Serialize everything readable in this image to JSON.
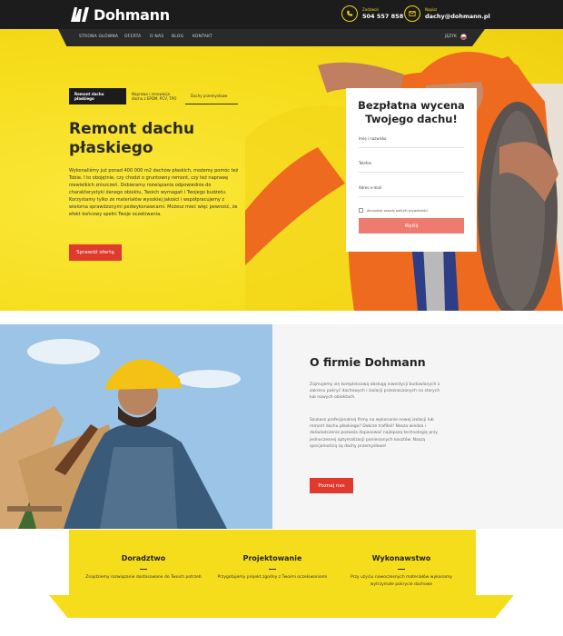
{
  "brand": {
    "name": "Dohmann"
  },
  "header": {
    "phone_label": "Zadzwoń",
    "phone": "504 557 858",
    "email_label": "Napisz",
    "email": "dachy@dohmann.pl"
  },
  "nav": {
    "items": [
      "STRONA GŁÓWNA",
      "OFERTA",
      "O NAS",
      "BLOG",
      "KONTAKT"
    ],
    "language_label": "JĘZYK"
  },
  "hero": {
    "tabs": [
      "Remont dachu płaskiego",
      "Naprawa i renowacja dachu z EPDM, PCV, TPO",
      "Dachy przemysłowe"
    ],
    "title": "Remont dachu płaskiego",
    "text": "Wykonaliśmy już ponad 400 000 m2 dachów płaskich, możemy pomóc też Tobie. I to obojętnie, czy chodzi o gruntowny remont, czy też naprawę niewielkich zniszczeń. Dobieramy rozwiązania odpowiednie do charakterystyki danego obiektu, Twoich wymagań i Twojego budżetu. Korzystamy tylko ze materiałów wysokiej jakości i współpracujemy z wieloma sprawdzonymi podwykonawcami. Możesz mieć więc pewność, że efekt końcowy spełni Twoje oczekiwania.",
    "cta": "Sprawdź ofertę"
  },
  "form": {
    "title_line1": "Bezpłatna wycena",
    "title_line2": "Twojego dachu!",
    "name_placeholder": "Imię i nazwisko",
    "phone_placeholder": "Telefon",
    "email_placeholder": "Adres e-mail",
    "consent": "Akceptuję zasady polityki prywatności",
    "submit": "Wyślij"
  },
  "about": {
    "title": "O firmie Dohmann",
    "p1": "Zajmujemy się kompleksową obsługą inwestycji budowlanych z zakresu pokryć dachowych i izolacji przeznaczonych na starych lub nowych obiektach.",
    "p2": "Szukasz profesjonalnej firmy na wykonanie nowej izolacji lub remont dachu płaskiego? Dobrze trafiłeś! Nasza wiedza i doświadczenie pozwala dopasować najlepszą technologię przy jednoczesnej optymalizacji poniesionych kosztów. Naszą specjalnością są dachy przemysłowe!",
    "cta": "Poznaj nas"
  },
  "services": [
    {
      "title": "Doradztwo",
      "text": "Znajdziemy rozwiązanie dostosowane do Twoich potrzeb"
    },
    {
      "title": "Projektowanie",
      "text": "Przygotujemy projekt zgodny z Twoimi oczekiwaniami"
    },
    {
      "title": "Wykonawstwo",
      "text": "Przy użyciu nowoczesnych materiałów wykonamy wytrzymałe pokrycie dachowe"
    }
  ],
  "colors": {
    "accent": "#f6dd1c",
    "cta": "#e03a2e",
    "dark": "#1c1c1c",
    "form_button": "#ee7b6f"
  },
  "icons": [
    "phone-icon",
    "mail-icon",
    "flag-icon",
    "checkbox-icon"
  ]
}
